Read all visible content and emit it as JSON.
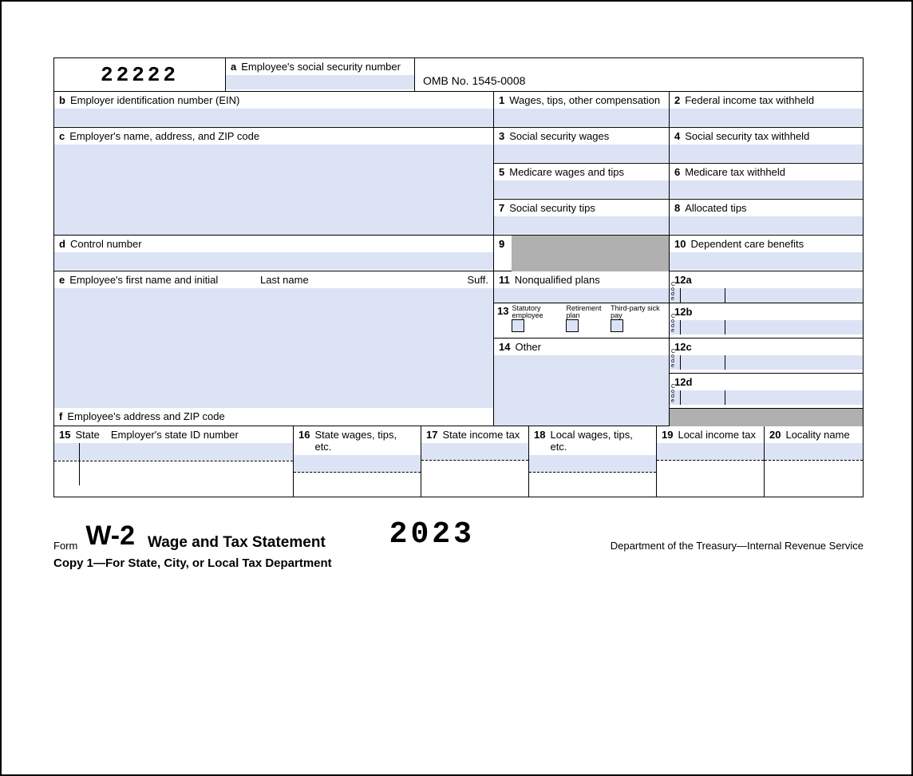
{
  "header": {
    "code22222": "22222",
    "box_a_label": "Employee's social security number",
    "omb": "OMB No. 1545-0008"
  },
  "boxes": {
    "b": "Employer identification number (EIN)",
    "c": "Employer's name, address, and ZIP code",
    "d": "Control number",
    "e_first": "Employee's first name and initial",
    "e_last": "Last name",
    "e_suff": "Suff.",
    "f": "Employee's address and ZIP code",
    "1": "Wages, tips, other compensation",
    "2": "Federal income tax withheld",
    "3": "Social security wages",
    "4": "Social security tax withheld",
    "5": "Medicare wages and tips",
    "6": "Medicare tax withheld",
    "7": "Social security tips",
    "8": "Allocated tips",
    "9": "",
    "10": "Dependent care benefits",
    "11": "Nonqualified plans",
    "12a": "12a",
    "12b": "12b",
    "12c": "12c",
    "12d": "12d",
    "code": "Code",
    "13_statutory": "Statutory employee",
    "13_retirement": "Retirement plan",
    "13_sickpay": "Third-party sick pay",
    "14": "Other",
    "15_state": "State",
    "15_ein": "Employer's state ID number",
    "16": "State wages, tips, etc.",
    "17": "State income tax",
    "18": "Local wages, tips, etc.",
    "19": "Local income tax",
    "20": "Locality name"
  },
  "footer": {
    "form_label": "Form",
    "form_name": "W-2",
    "title": "Wage and Tax Statement",
    "year": "2023",
    "dept": "Department of the Treasury—Internal Revenue Service",
    "copy": "Copy 1—For State, City, or Local Tax Department"
  }
}
